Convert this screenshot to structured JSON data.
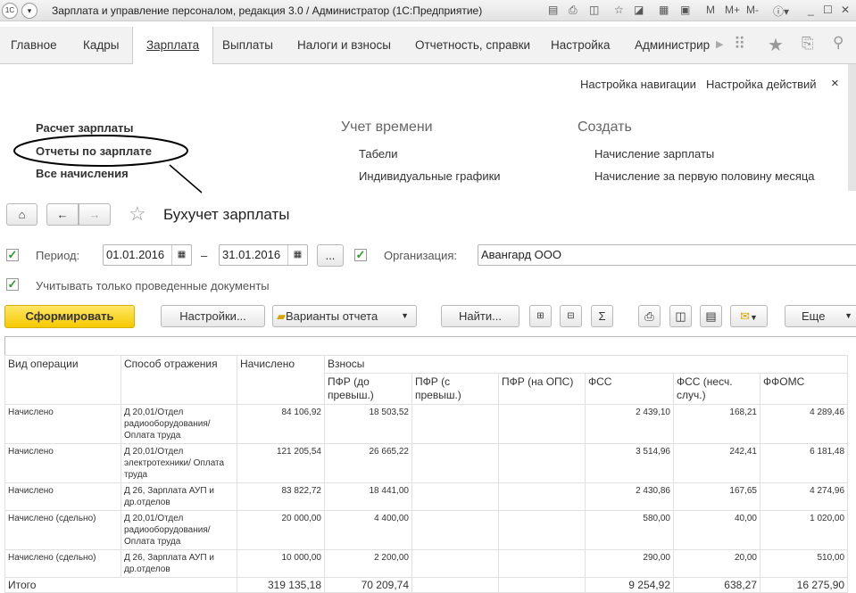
{
  "window": {
    "title": "Зарплата и управление персоналом, редакция 3.0 / Администратор  (1С:Предприятие)",
    "logo": "1С",
    "tools": [
      "M",
      "M+",
      "M-"
    ]
  },
  "menu": {
    "tabs": [
      "Главное",
      "Кадры",
      "Зарплата",
      "Выплаты",
      "Налоги и взносы",
      "Отчетность, справки",
      "Настройка",
      "Администрир"
    ],
    "active": "Зарплата"
  },
  "nav": {
    "settings_nav": "Настройка навигации",
    "settings_actions": "Настройка действий",
    "col1": [
      "Расчет зарплаты",
      "Отчеты по зарплате",
      "Все начисления"
    ],
    "col2_header": "Учет времени",
    "col2": [
      "Табели",
      "Индивидуальные графики"
    ],
    "col3_header": "Создать",
    "col3": [
      "Начисление зарплаты",
      "Начисление за первую половину месяца"
    ]
  },
  "report": {
    "title": "Бухучет зарплаты",
    "period_label": "Период:",
    "date_from": "01.01.2016",
    "dash": "–",
    "date_to": "31.01.2016",
    "ellipsis": "...",
    "org_label": "Организация:",
    "org_value": "Авангард ООО",
    "posted_only": "Учитывать только проведенные документы",
    "btn_generate": "Сформировать",
    "btn_settings": "Настройки...",
    "btn_variants": "Варианты отчета",
    "btn_find": "Найти...",
    "btn_sum": "Σ",
    "btn_more": "Еще"
  },
  "table": {
    "h_op": "Вид операции",
    "h_method": "Способ отражения",
    "h_accr": "Начислено",
    "h_contrib": "Взносы",
    "sub": [
      "ПФР (до превыш.)",
      "ПФР (с превыш.)",
      "ПФР (на ОПС)",
      "ФСС",
      "ФСС (несч. случ.)",
      "ФФОМС"
    ],
    "rows": [
      [
        "Начислено",
        "Д 20,01/Отдел радиооборудования/ Оплата труда",
        "84 106,92",
        "18 503,52",
        "",
        "",
        "2 439,10",
        "168,21",
        "4 289,46"
      ],
      [
        "Начислено",
        "Д 20,01/Отдел электротехники/ Оплата труда",
        "121 205,54",
        "26 665,22",
        "",
        "",
        "3 514,96",
        "242,41",
        "6 181,48"
      ],
      [
        "Начислено",
        "Д 26, Зарплата АУП и др.отделов",
        "83 822,72",
        "18 441,00",
        "",
        "",
        "2 430,86",
        "167,65",
        "4 274,96"
      ],
      [
        "Начислено (сдельно)",
        "Д 20,01/Отдел радиооборудования/ Оплата труда",
        "20 000,00",
        "4 400,00",
        "",
        "",
        "580,00",
        "40,00",
        "1 020,00"
      ],
      [
        "Начислено (сдельно)",
        "Д 26, Зарплата АУП и др.отделов",
        "10 000,00",
        "2 200,00",
        "",
        "",
        "290,00",
        "20,00",
        "510,00"
      ]
    ],
    "total": [
      "Итого",
      "319 135,18",
      "70 209,74",
      "",
      "",
      "9 254,92",
      "638,27",
      "16 275,90"
    ]
  }
}
